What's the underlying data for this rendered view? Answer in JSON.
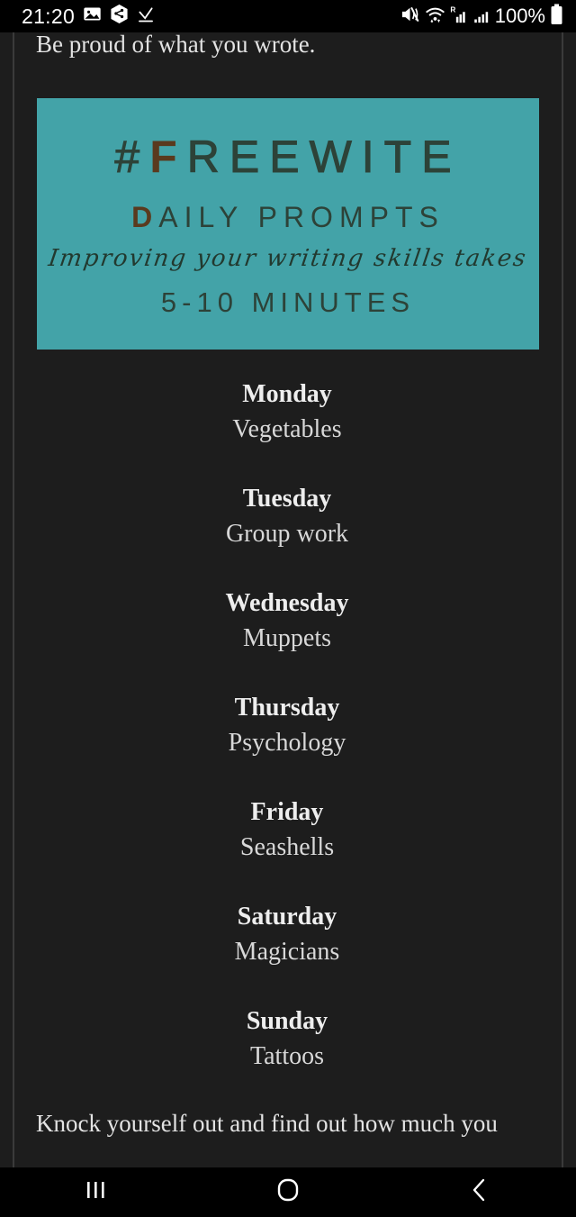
{
  "status_bar": {
    "clock": "21:20",
    "battery_percent": "100%",
    "left_icons": [
      "image-icon",
      "share-hexagon-icon",
      "download-complete-icon"
    ],
    "right_icons": [
      "mute-icon",
      "wifi-icon",
      "roaming-signal-icon",
      "signal-icon",
      "battery-icon"
    ],
    "roaming_label": "R"
  },
  "article": {
    "intro_text": "Be proud of what you wrote.",
    "outro_text": "Knock yourself out and find out how much you"
  },
  "banner": {
    "title_prefix": "#",
    "title_accent": "F",
    "title_rest": "REEWITE",
    "subtitle_accent": "D",
    "subtitle_rest": "AILY PROMPTS",
    "script_line": "Improving your writing skills takes",
    "duration": "5-10 MINUTES",
    "background_color": "#43a3a8",
    "text_color": "#2d4238",
    "accent_color": "#5a3a1e"
  },
  "prompts": [
    {
      "day": "Monday",
      "topic": "Vegetables"
    },
    {
      "day": "Tuesday",
      "topic": "Group work"
    },
    {
      "day": "Wednesday",
      "topic": "Muppets"
    },
    {
      "day": "Thursday",
      "topic": "Psychology"
    },
    {
      "day": "Friday",
      "topic": "Seashells"
    },
    {
      "day": "Saturday",
      "topic": "Magicians"
    },
    {
      "day": "Sunday",
      "topic": "Tattoos"
    }
  ],
  "nav_bar": {
    "recents_label": "recents-icon",
    "home_label": "home-icon",
    "back_label": "back-icon"
  }
}
